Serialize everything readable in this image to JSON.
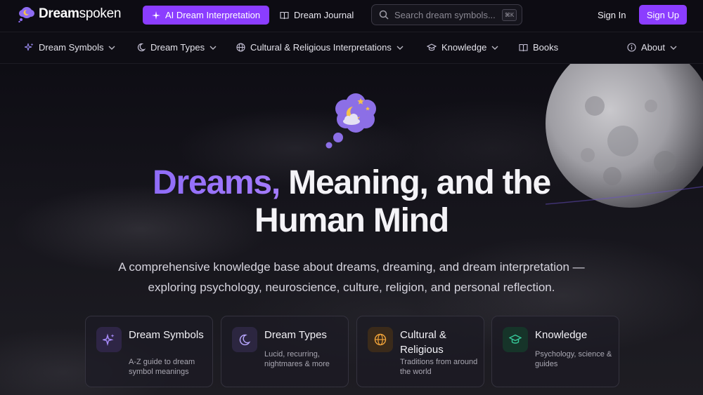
{
  "header": {
    "logo_bold": "Dream",
    "logo_light": "spoken",
    "ai_button": "AI Dream Interpretation",
    "journal_link": "Dream Journal",
    "search_placeholder": "Search dream symbols...",
    "search_shortcut": "⌘K",
    "sign_in": "Sign In",
    "sign_up": "Sign Up"
  },
  "subnav": {
    "symbols": "Dream Symbols",
    "types": "Dream Types",
    "cultural": "Cultural & Religious Interpretations",
    "knowledge": "Knowledge",
    "books": "Books",
    "about": "About"
  },
  "hero": {
    "title_accent": "Dreams,",
    "title_rest1": " Meaning, and the",
    "title_rest2": "Human Mind",
    "subtitle_line1": "A comprehensive knowledge base about dreams, dreaming, and dream interpretation —",
    "subtitle_line2": "exploring psychology, neuroscience, culture, religion, and personal reflection."
  },
  "cards": [
    {
      "title": "Dream Symbols",
      "desc": "A-Z guide to dream symbol meanings",
      "icon": "sparkles-icon",
      "color": "#a98cff",
      "bg": "#2e2545"
    },
    {
      "title": "Dream Types",
      "desc": "Lucid, recurring, nightmares & more",
      "icon": "moon-icon",
      "color": "#b8a6ff",
      "bg": "#2c2640"
    },
    {
      "title": "Cultural & Religious",
      "desc": "Traditions from around the world",
      "icon": "globe-icon",
      "color": "#f2a43a",
      "bg": "#3a2a1a"
    },
    {
      "title": "Knowledge",
      "desc": "Psychology, science & guides",
      "icon": "graduation-cap-icon",
      "color": "#36c99a",
      "bg": "#163429"
    }
  ],
  "colors": {
    "accent": "#8b3dff",
    "background": "#0c0b12"
  }
}
